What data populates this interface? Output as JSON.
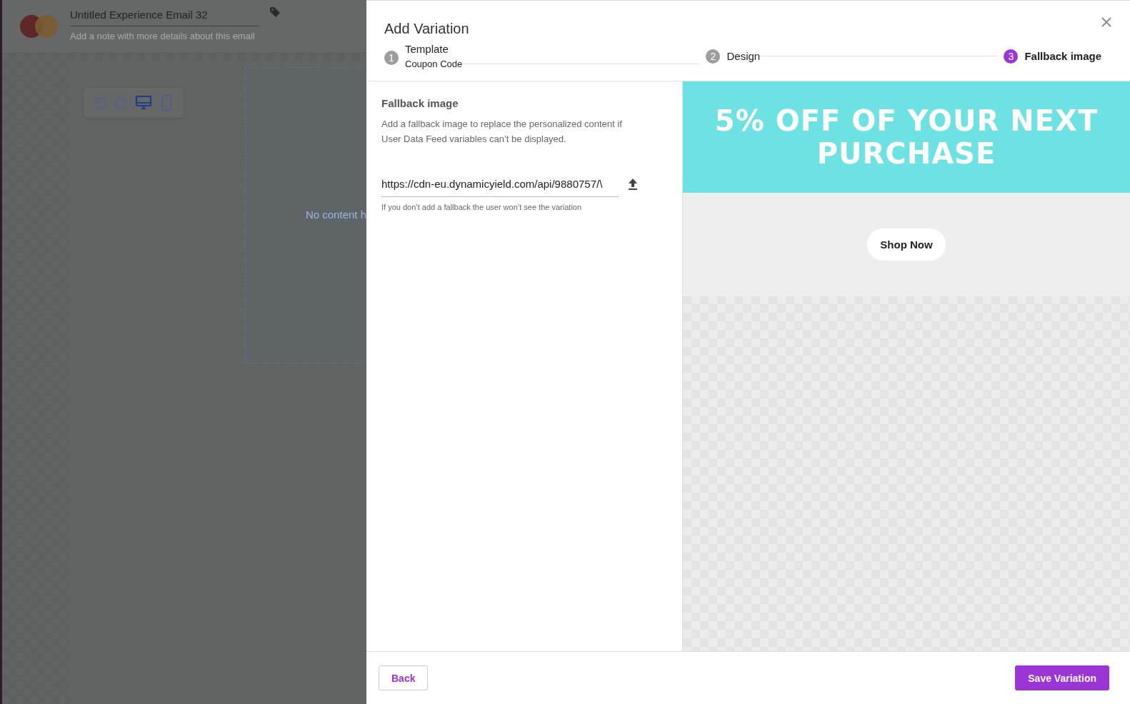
{
  "editor": {
    "title": "Untitled Experience Email 32",
    "note_placeholder": "Add a note with more details about this email",
    "toolbar": [
      {
        "kind": "undo"
      },
      {
        "kind": "redo"
      }
    ],
    "devices": [
      {
        "kind": "desktop",
        "selected": true
      },
      {
        "kind": "mobile",
        "selected": false
      }
    ],
    "canvas_text": "No content h"
  },
  "modal": {
    "title": "Add Variation",
    "steps": [
      {
        "number": "1",
        "label": "Template",
        "sublabel": "Coupon Code",
        "selected": false
      },
      {
        "number": "2",
        "label": "Design",
        "selected": false
      },
      {
        "number": "3",
        "label": "Fallback image",
        "selected": true
      }
    ],
    "section_title": "Fallback image",
    "description": "Add a fallback image to replace the personalized content if User Data Feed variables can’t be displayed.",
    "url_field": {
      "value": "https://cdn-eu.dynamicyield.com/api/9880757/\\",
      "helper": "If you don’t add a fallback the user won’t see the variation"
    },
    "preview": {
      "banner": "5% OFF OF YOUR NEXT PURCHASE",
      "button": "Shop Now"
    },
    "buttons": [
      {
        "kind": "secondary",
        "label": "Back"
      },
      {
        "kind": "primary",
        "label": "Save Variation"
      }
    ]
  }
}
